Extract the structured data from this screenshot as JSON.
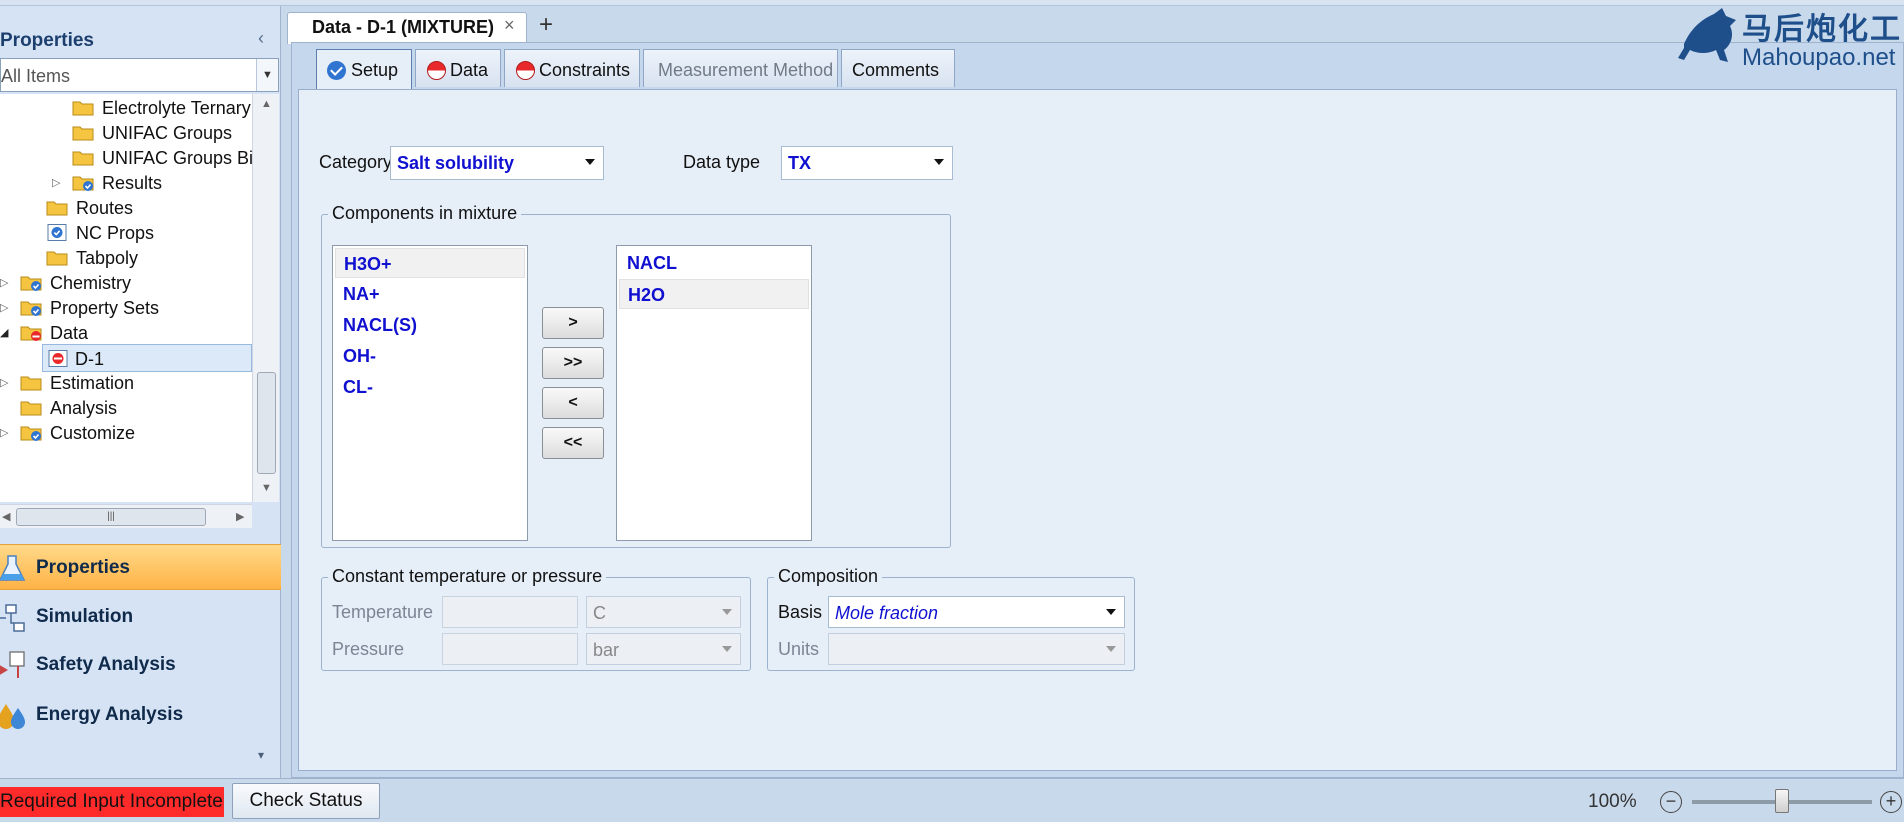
{
  "nav": {
    "title": "Properties",
    "filter_value": "All Items",
    "tree": [
      {
        "label": "Electrolyte Ternary",
        "icon": "folder-icon"
      },
      {
        "label": "UNIFAC Groups",
        "icon": "folder-icon"
      },
      {
        "label": "UNIFAC Groups Bin",
        "icon": "folder-icon"
      },
      {
        "label": "Results",
        "icon": "folder-check-icon"
      },
      {
        "label": "Routes",
        "icon": "folder-icon"
      },
      {
        "label": "NC Props",
        "icon": "form-check-icon"
      },
      {
        "label": "Tabpoly",
        "icon": "folder-icon"
      },
      {
        "label": "Chemistry",
        "icon": "folder-check-icon"
      },
      {
        "label": "Property Sets",
        "icon": "folder-check-icon"
      },
      {
        "label": "Data",
        "icon": "folder-error-icon"
      },
      {
        "label": "D-1",
        "icon": "form-error-icon"
      },
      {
        "label": "Estimation",
        "icon": "folder-icon"
      },
      {
        "label": "Analysis",
        "icon": "folder-icon"
      },
      {
        "label": "Customize",
        "icon": "folder-check-icon"
      }
    ],
    "buttons": {
      "properties": "Properties",
      "simulation": "Simulation",
      "safety": "Safety Analysis",
      "energy": "Energy Analysis"
    }
  },
  "doc_tab": {
    "title": "Data - D-1 (MIXTURE)"
  },
  "form_tabs": [
    {
      "label": "Setup",
      "status": "complete"
    },
    {
      "label": "Data",
      "status": "incomplete"
    },
    {
      "label": "Constraints",
      "status": "incomplete"
    },
    {
      "label": "Measurement Method",
      "status": "disabled"
    },
    {
      "label": "Comments",
      "status": "none"
    }
  ],
  "setup": {
    "category_label": "Category",
    "category_value": "Salt solubility",
    "datatype_label": "Data type",
    "datatype_value": "TX",
    "components_group": "Components in mixture",
    "available": [
      "H3O+",
      "NA+",
      "NACL(S)",
      "OH-",
      "CL-"
    ],
    "selected": [
      "NACL",
      "H2O"
    ],
    "move_buttons": [
      ">",
      ">>",
      "<",
      "<<"
    ],
    "constant_group": "Constant temperature or pressure",
    "temperature_label": "Temperature",
    "temperature_unit": "C",
    "pressure_label": "Pressure",
    "pressure_unit": "bar",
    "composition_group": "Composition",
    "basis_label": "Basis",
    "basis_value": "Mole fraction",
    "units_label": "Units"
  },
  "statusbar": {
    "required": "Required Input Incomplete",
    "check_status": "Check Status",
    "zoom": "100%",
    "zoom_level": 0.5
  },
  "watermark": {
    "cn": "马后炮化工",
    "en": "Mahoupao.net"
  },
  "colors": {
    "accent": "#1010d0",
    "nav_active": "#ffb346",
    "error": "#ff2b2b"
  }
}
